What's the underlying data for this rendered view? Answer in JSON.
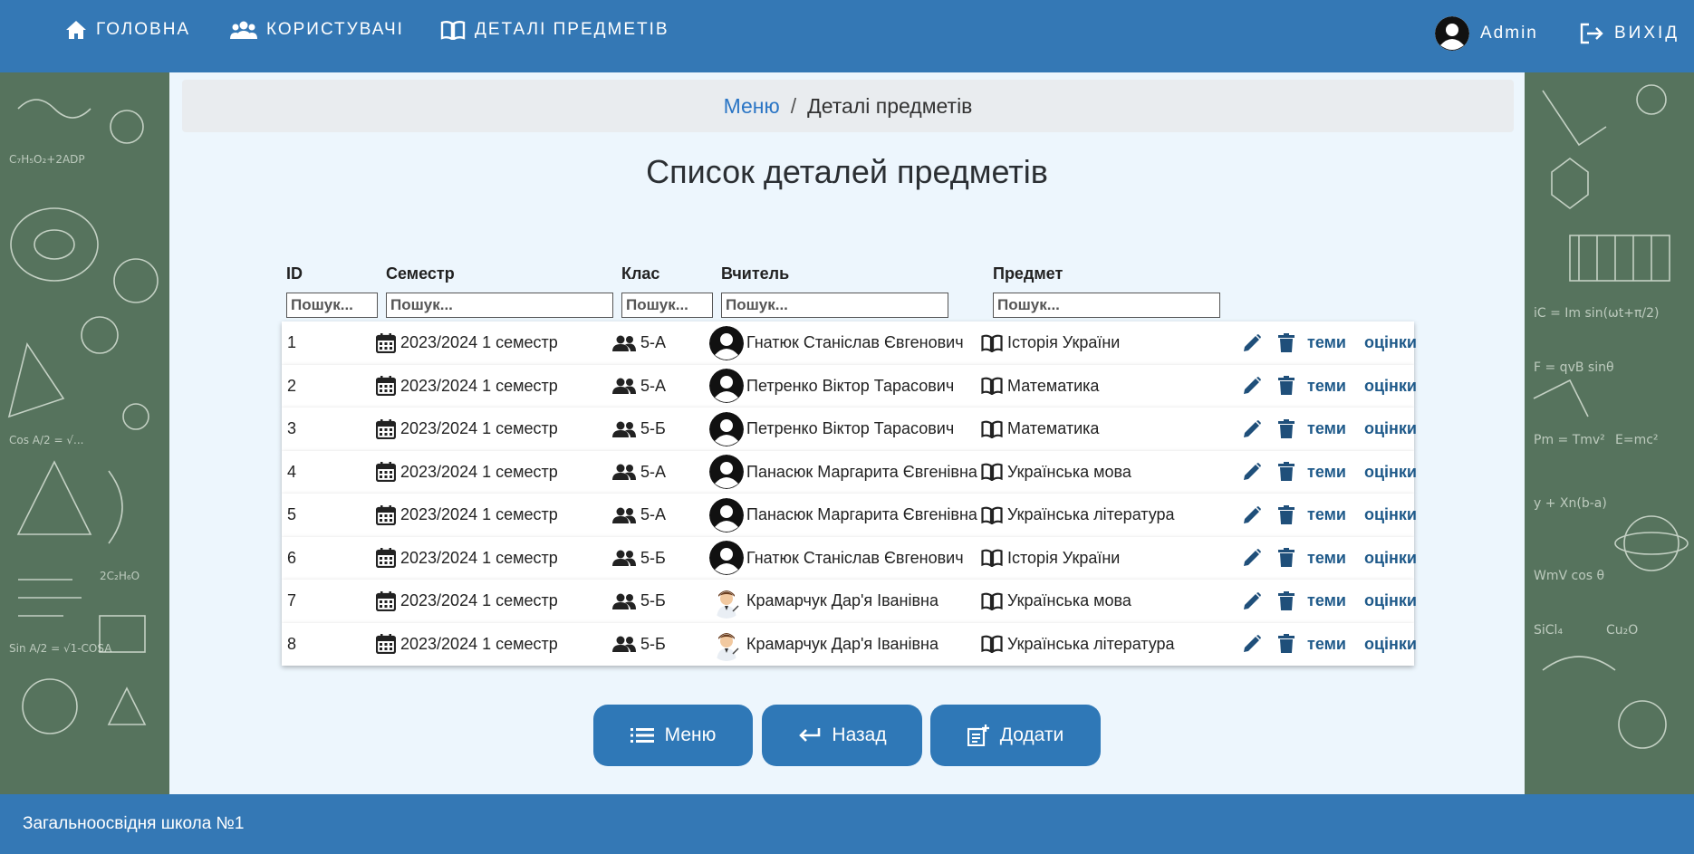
{
  "nav": {
    "home": "ГОЛОВНА",
    "users": "КОРИСТУВАЧІ",
    "subjects": "ДЕТАЛІ ПРЕДМЕТІВ",
    "admin": "Admin",
    "logout": "ВИХІД"
  },
  "breadcrumb": {
    "menu": "Меню",
    "separator": "/",
    "current": "Деталі предметів"
  },
  "title": "Список деталей предметів",
  "columns": {
    "id": "ID",
    "semester": "Семестр",
    "class": "Клас",
    "teacher": "Вчитель",
    "subject": "Предмет"
  },
  "search_placeholder": "Пошук...",
  "row_actions": {
    "topics": "теми",
    "grades": "оцінки",
    "edit_icon": "pencil-icon",
    "delete_icon": "trash-icon"
  },
  "rows": [
    {
      "id": "1",
      "semester": "2023/2024 1 семестр",
      "class": "5-А",
      "teacher": "Гнатюк Станіслав Євгенович",
      "subject": "Історія України",
      "avatar": "user-circle-icon"
    },
    {
      "id": "2",
      "semester": "2023/2024 1 семестр",
      "class": "5-А",
      "teacher": "Петренко Віктор Тарасович",
      "subject": "Математика",
      "avatar": "user-circle-icon"
    },
    {
      "id": "3",
      "semester": "2023/2024 1 семестр",
      "class": "5-Б",
      "teacher": "Петренко Віктор Тарасович",
      "subject": "Математика",
      "avatar": "user-circle-icon"
    },
    {
      "id": "4",
      "semester": "2023/2024 1 семестр",
      "class": "5-А",
      "teacher": "Панасюк Маргарита Євгенівна",
      "subject": "Українська мова",
      "avatar": "user-circle-icon"
    },
    {
      "id": "5",
      "semester": "2023/2024 1 семестр",
      "class": "5-А",
      "teacher": "Панасюк Маргарита Євгенівна",
      "subject": "Українська література",
      "avatar": "user-circle-icon"
    },
    {
      "id": "6",
      "semester": "2023/2024 1 семестр",
      "class": "5-Б",
      "teacher": "Гнатюк Станіслав Євгенович",
      "subject": "Історія України",
      "avatar": "user-circle-icon"
    },
    {
      "id": "7",
      "semester": "2023/2024 1 семестр",
      "class": "5-Б",
      "teacher": "Крамарчук Дар'я Іванівна",
      "subject": "Українська мова",
      "avatar": "teacher-photo-icon"
    },
    {
      "id": "8",
      "semester": "2023/2024 1 семестр",
      "class": "5-Б",
      "teacher": "Крамарчук Дар'я Іванівна",
      "subject": "Українська література",
      "avatar": "teacher-photo-icon"
    }
  ],
  "buttons": {
    "menu": "Меню",
    "back": "Назад",
    "add": "Додати"
  },
  "footer": "Загальноосвідня школа №1",
  "colors": {
    "header": "#3478b5",
    "panel": "#edf6fd",
    "button": "#2f78b7",
    "link": "#2a75c5",
    "action": "#1f5a8a",
    "chalkboard": "#56735d"
  }
}
